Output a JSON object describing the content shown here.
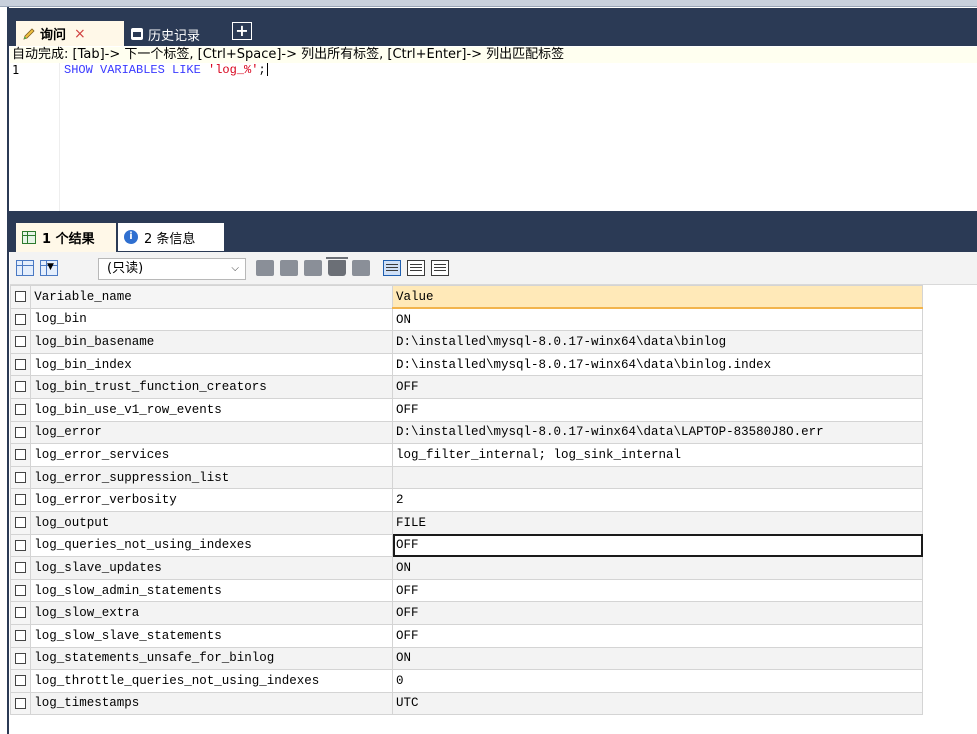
{
  "tabs": {
    "query_label": "询问",
    "query_close": "×",
    "history_label": "历史记录",
    "add": "+"
  },
  "editor": {
    "autocomplete_hint": "自动完成: [Tab]-> 下一个标签, [Ctrl+Space]-> 列出所有标签, [Ctrl+Enter]-> 列出匹配标签",
    "line_number": "1",
    "sql_keyword": "SHOW VARIABLES LIKE ",
    "sql_string": "'log_%'",
    "sql_end": ";"
  },
  "result_tabs": {
    "results_label": "1 个结果",
    "messages_label": "2 条信息",
    "info_icon": "i"
  },
  "toolbar": {
    "mode_select": "(只读)"
  },
  "grid": {
    "headers": {
      "name": "Variable_name",
      "value": "Value"
    },
    "rows": [
      {
        "name": "log_bin",
        "value": "ON"
      },
      {
        "name": "log_bin_basename",
        "value": "D:\\installed\\mysql-8.0.17-winx64\\data\\binlog"
      },
      {
        "name": "log_bin_index",
        "value": "D:\\installed\\mysql-8.0.17-winx64\\data\\binlog.index"
      },
      {
        "name": "log_bin_trust_function_creators",
        "value": "OFF"
      },
      {
        "name": "log_bin_use_v1_row_events",
        "value": "OFF"
      },
      {
        "name": "log_error",
        "value": "D:\\installed\\mysql-8.0.17-winx64\\data\\LAPTOP-83580J8O.err"
      },
      {
        "name": "log_error_services",
        "value": "log_filter_internal; log_sink_internal"
      },
      {
        "name": "log_error_suppression_list",
        "value": ""
      },
      {
        "name": "log_error_verbosity",
        "value": "2"
      },
      {
        "name": "log_output",
        "value": "FILE"
      },
      {
        "name": "log_queries_not_using_indexes",
        "value": "OFF"
      },
      {
        "name": "log_slave_updates",
        "value": "ON"
      },
      {
        "name": "log_slow_admin_statements",
        "value": "OFF"
      },
      {
        "name": "log_slow_extra",
        "value": "OFF"
      },
      {
        "name": "log_slow_slave_statements",
        "value": "OFF"
      },
      {
        "name": "log_statements_unsafe_for_binlog",
        "value": "ON"
      },
      {
        "name": "log_throttle_queries_not_using_indexes",
        "value": "0"
      },
      {
        "name": "log_timestamps",
        "value": "UTC"
      }
    ],
    "selected_row": 10
  },
  "colors": {
    "accent_dark": "#2b3a55",
    "header_value_bg": "#ffe9b8",
    "keyword": "#3a3aff",
    "string": "#d8001a"
  },
  "icons": {
    "query_tab": "pencil-icon",
    "history_tab": "calendar-icon",
    "results_tab": "grid-icon",
    "messages_tab": "info-icon"
  }
}
